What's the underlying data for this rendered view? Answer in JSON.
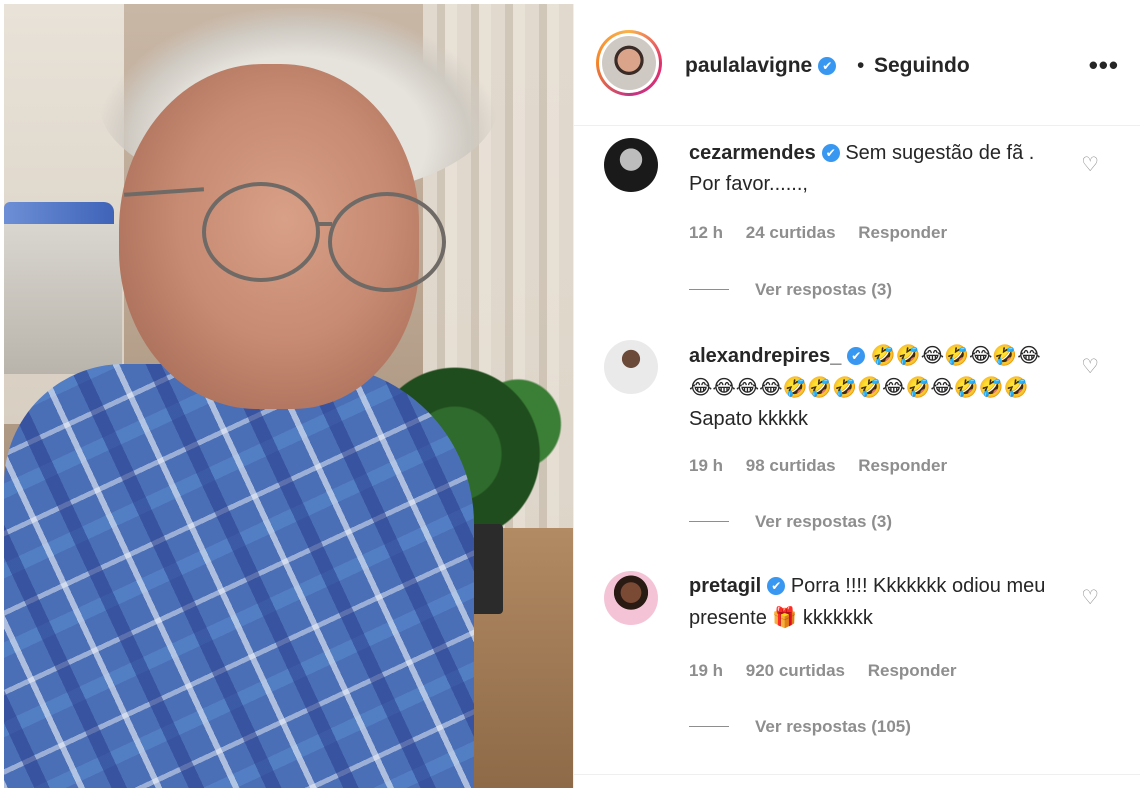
{
  "post": {
    "author": "paulalavigne",
    "verified_mark": "✔",
    "separator": "•",
    "follow_state": "Seguindo",
    "more_label": "•••"
  },
  "comments": [
    {
      "username": "cezarmendes",
      "verified_mark": "✔",
      "text": "Sem sugestão de fã . Por favor......,",
      "time": "12 h",
      "likes": "24 curtidas",
      "reply": "Responder",
      "view_replies": "Ver respostas (3)",
      "heart_icon": "♡"
    },
    {
      "username": "alexandrepires_",
      "verified_mark": "✔",
      "emojis_line": "🤣🤣😂🤣😂🤣😂😂😂😂😂🤣🤣🤣🤣😂🤣😂🤣🤣🤣",
      "text": "Sapato kkkkk",
      "time": "19 h",
      "likes": "98 curtidas",
      "reply": "Responder",
      "view_replies": "Ver respostas (3)",
      "heart_icon": "♡"
    },
    {
      "username": "pretagil",
      "verified_mark": "✔",
      "text_before": "Porra !!!! Kkkkkkk odiou meu presente",
      "gift_emoji": "🎁",
      "text_after": "kkkkkkk",
      "time": "19 h",
      "likes": "920 curtidas",
      "reply": "Responder",
      "view_replies": "Ver respostas (105)",
      "heart_icon": "♡"
    }
  ],
  "colors": {
    "verified": "#3897f0",
    "muted": "#8e8e8e",
    "text": "#262626"
  }
}
